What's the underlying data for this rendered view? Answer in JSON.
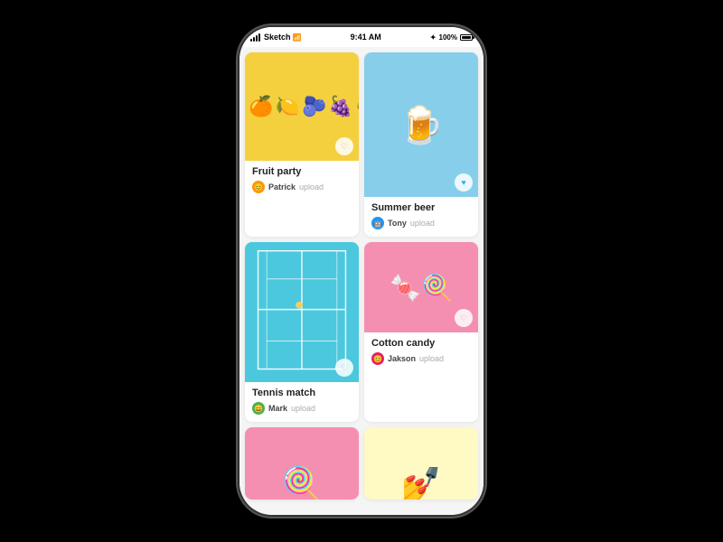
{
  "status_bar": {
    "signal": "•••",
    "carrier": "Sketch",
    "wifi": "WiFi",
    "time": "9:41 AM",
    "bluetooth": "BT",
    "battery_pct": "100%"
  },
  "cards": [
    {
      "id": "fruit-party",
      "title": "Fruit party",
      "author": "Patrick",
      "action": "upload",
      "avatar_emoji": "👦",
      "avatar_class": "avatar-patrick",
      "heart_active": false,
      "col": "left",
      "image_type": "fruit"
    },
    {
      "id": "summer-beer",
      "title": "Summer beer",
      "author": "Tony",
      "action": "upload",
      "avatar_emoji": "🧑",
      "avatar_class": "avatar-tony",
      "heart_active": true,
      "col": "right",
      "image_type": "beer"
    },
    {
      "id": "tennis-match",
      "title": "Tennis match",
      "author": "Mark",
      "action": "upload",
      "avatar_emoji": "👤",
      "avatar_class": "avatar-mark",
      "heart_active": false,
      "col": "left",
      "image_type": "tennis"
    },
    {
      "id": "cotton-candy",
      "title": "Cotton candy",
      "author": "Jakson",
      "action": "upload",
      "avatar_emoji": "🧒",
      "avatar_class": "avatar-jakson",
      "heart_active": false,
      "col": "right",
      "image_type": "candy"
    },
    {
      "id": "lollipop",
      "title": "",
      "author": "",
      "action": "",
      "col": "left",
      "image_type": "lollipop"
    },
    {
      "id": "nails",
      "title": "",
      "author": "",
      "action": "",
      "col": "right",
      "image_type": "nails"
    }
  ]
}
